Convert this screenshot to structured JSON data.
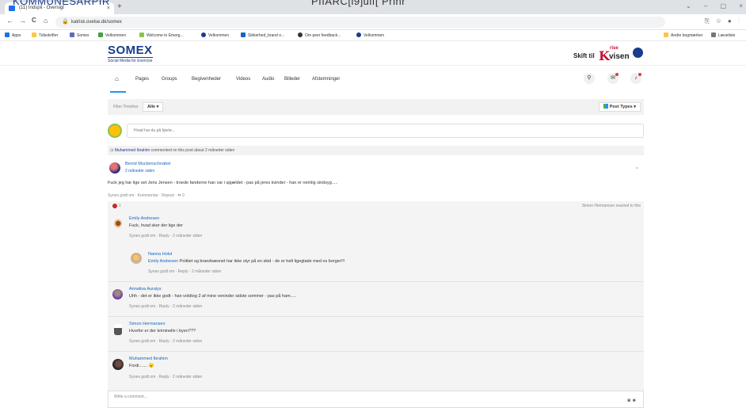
{
  "browser": {
    "tab_title": "(11) Indspil - Oversigt",
    "tab_close": "×",
    "new_tab": "+",
    "overlay_left": "KOMMUNESARPIR",
    "overlay_center": "PIIARC[i9]uif[ Prinr",
    "window_controls": "⌄ – ▢ ×",
    "back": "←",
    "forward": "→",
    "reload": "C",
    "home": "⌂",
    "url": "katrisk.ovelse.dk/somex",
    "addr_icons": "⎘ ☆ ● ⋮"
  },
  "bookmarks": [
    {
      "label": "Apps",
      "color": "#1a73e8"
    },
    {
      "label": "Tidsskrifter",
      "color": "#f9c844"
    },
    {
      "label": "Somex",
      "color": "#5c6bc0"
    },
    {
      "label": "Velkommen",
      "color": "#43a047"
    },
    {
      "label": "Welcome to Emerg...",
      "color": "#8bc34a"
    },
    {
      "label": "Velkommen",
      "color": "#1a3c8c"
    },
    {
      "label": "Sikkerhed_brand o...",
      "color": "#1565c0"
    },
    {
      "label": "Om peer feedback...",
      "color": "#333333"
    },
    {
      "label": "Velkommen",
      "color": "#1a3c8c"
    }
  ],
  "bookmarks_right": [
    "Andre bogmærker",
    "Læseliste"
  ],
  "site": {
    "logo_title": "SOMEX",
    "logo_sub": "Social Media for Exercise",
    "switch_label": "Skift til",
    "krise_k": "K",
    "krise_r": "rise",
    "krise_v": "visen"
  },
  "nav": {
    "home_icon": "⌂",
    "items": [
      "Pages",
      "Groups",
      "Begivenheder",
      "Videos",
      "Audio",
      "Billeder",
      "Afstemninger"
    ],
    "search_icon": "⚲",
    "mail_icon": "✉",
    "bell_icon": "♪"
  },
  "filter": {
    "label": "Filter Timeline:",
    "value": "Alle ▾",
    "post_types": "Post Types ▾"
  },
  "composer": {
    "placeholder": "Hvad har du på hjerte..."
  },
  "post": {
    "activity_icon": "◷",
    "activity_name": "Muhammed Ibrahim",
    "activity_text": "commented on this post about 2 måneder siden",
    "author": "Bernd Muckenschnabel",
    "time": "2 måneder siden",
    "text": "Fuck jeg har lige set Jens Jensen - troede fanderne han var i spjældet - pas på jeres kvinder - han er nemlig sindsyg.....",
    "actions": "Synes godt om  ·  Kommentar  ·  Repost  ·  ⇆ 0",
    "chevron": "⌄",
    "reaction_count": "1",
    "reacted_by": "Simon Hermansen reacted to this"
  },
  "comments": [
    {
      "name": "Emily Andresen",
      "text": "Fuck, hvad sker der lige der",
      "actions": "Synes godt om  ·  Reply  ·  2 måneder siden"
    },
    {
      "name": "Nanna Holst",
      "mention": "Emily Andresen",
      "text": "Politiet og brandvæsnet har ikke styr på en skid - de er helt ligeglade med os borger!!!",
      "actions": "Synes godt om  ·  Reply  ·  2 måneder siden"
    },
    {
      "name": "Annaliva Auralys",
      "text": "Uhh - det er ikke godt - han voldtog 2 af mine veninder sidste sommer - pas på ham.....",
      "actions": "Synes godt om  ·  Reply  ·  2 måneder siden"
    },
    {
      "name": "Simon Hermansen",
      "text": "Hvorfor er der kriminelle i byen???",
      "actions": "Synes godt om  ·  Reply  ·  2 måneder siden"
    },
    {
      "name": "Muhammed Ibrahim",
      "text": "Fordi.......",
      "emoji": "😠",
      "actions": "Synes godt om  ·  Reply  ·  2 måneder siden"
    }
  ],
  "write": {
    "placeholder": "Write a comment...",
    "icons": "◙ ☻"
  }
}
